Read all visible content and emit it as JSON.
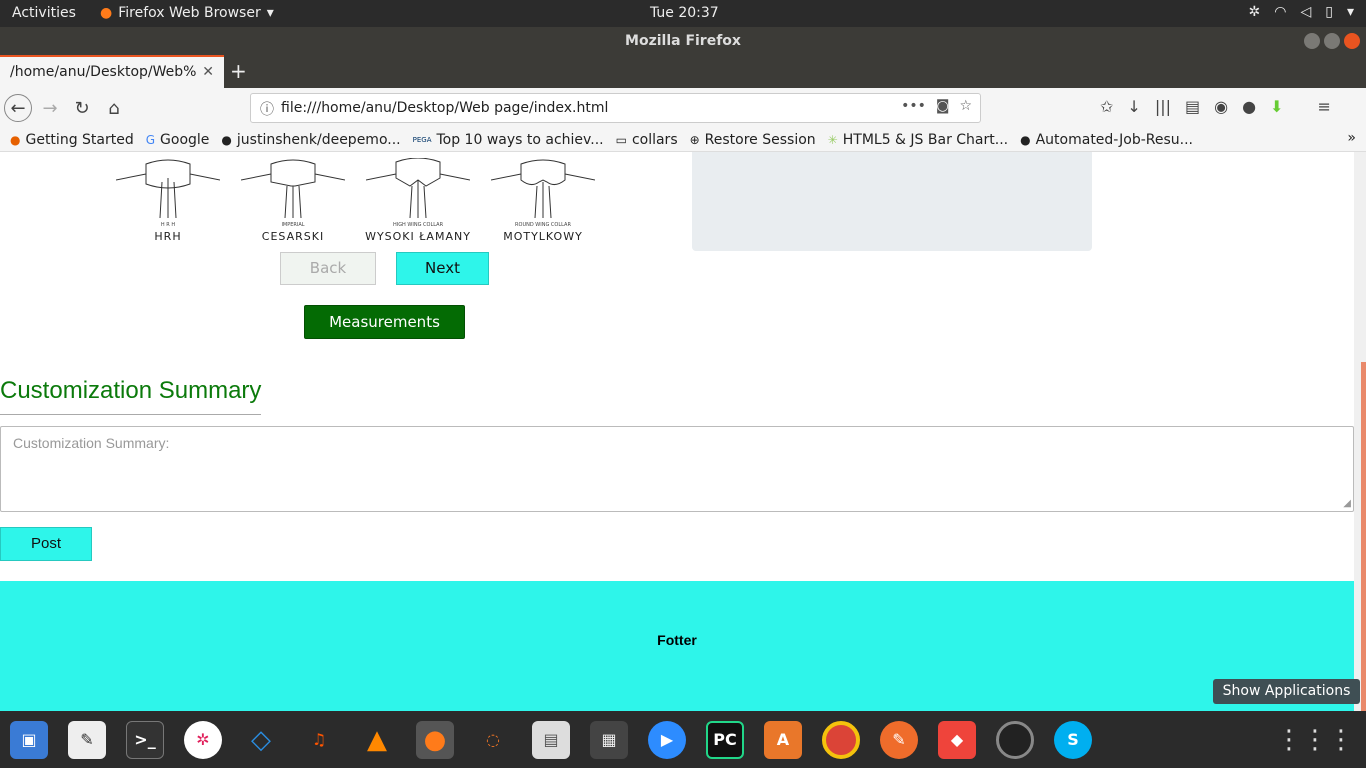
{
  "topbar": {
    "activities": "Activities",
    "app_name": "Firefox Web Browser",
    "clock": "Tue 20:37"
  },
  "window": {
    "title": "Mozilla Firefox"
  },
  "tab": {
    "title": "/home/anu/Desktop/Web%"
  },
  "url": "file:///home/anu/Desktop/Web page/index.html",
  "bookmarks": [
    {
      "label": "Getting Started",
      "icon": "firefox-icon"
    },
    {
      "label": "Google",
      "icon": "google-icon"
    },
    {
      "label": "justinshenk/deepemo...",
      "icon": "github-icon"
    },
    {
      "label": "Top 10 ways to achiev...",
      "icon": "pega-icon"
    },
    {
      "label": "collars",
      "icon": "folder-icon"
    },
    {
      "label": "Restore Session",
      "icon": "globe-icon"
    },
    {
      "label": "HTML5 & JS Bar Chart...",
      "icon": "chart-icon"
    },
    {
      "label": "Automated-Job-Resu...",
      "icon": "github-icon"
    }
  ],
  "collars": [
    {
      "sub": "H R H",
      "label": "HRH"
    },
    {
      "sub": "IMPERIAL",
      "label": "CESARSKI"
    },
    {
      "sub": "HIGH WING COLLAR",
      "label": "WYSOKI ŁAMANY"
    },
    {
      "sub": "ROUND WING COLLAR",
      "label": "MOTYLKOWY"
    }
  ],
  "buttons": {
    "back": "Back",
    "next": "Next",
    "measurements": "Measurements",
    "post": "Post"
  },
  "summary": {
    "title": "Customization Summary",
    "placeholder": "Customization Summary:"
  },
  "footer": {
    "text": "Fotter"
  },
  "dock": {
    "show_apps": "Show Applications"
  },
  "colors": {
    "accent": "#2ef5ea",
    "green": "#046b04",
    "title_green": "#0b7a0b"
  }
}
